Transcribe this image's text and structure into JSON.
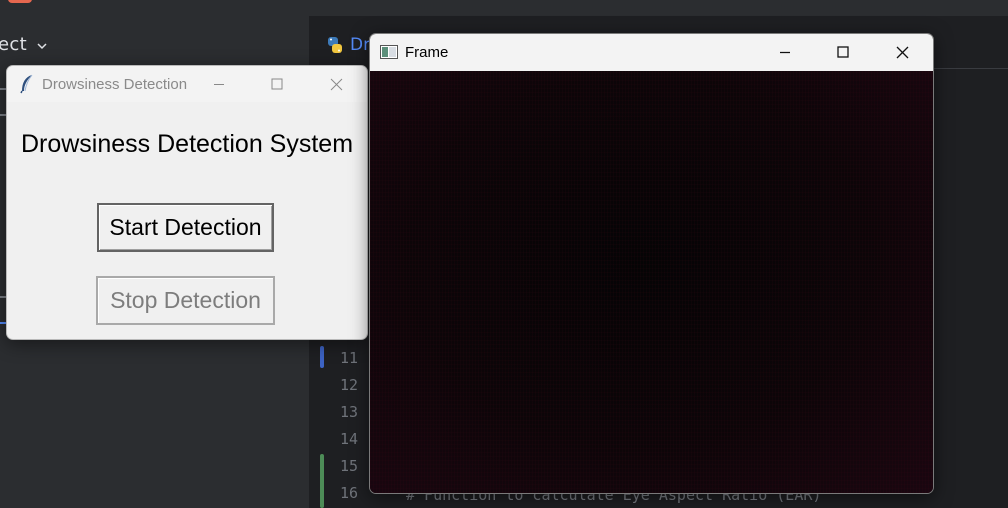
{
  "ide": {
    "project_title": "ect",
    "editor_tab_label": "Dr",
    "line_numbers": [
      "11",
      "12",
      "13",
      "14",
      "15",
      "16"
    ],
    "code_comment": "# Function to calculate Eye Aspect Ratio (EAR)",
    "colors": {
      "background": "#1e1f22",
      "panel": "#2b2d30",
      "accent": "#548af7"
    }
  },
  "tk_window": {
    "title": "Drowsiness Detection",
    "heading": "Drowsiness Detection System",
    "start_button_label": "Start Detection",
    "stop_button_label": "Stop Detection",
    "stop_button_enabled": false,
    "icons": [
      "feather-icon",
      "minimize-icon",
      "maximize-icon",
      "close-icon"
    ]
  },
  "frame_window": {
    "title": "Frame",
    "icons": [
      "app-icon",
      "minimize-icon",
      "maximize-icon",
      "close-icon"
    ],
    "video_tint": "#1a0610"
  }
}
